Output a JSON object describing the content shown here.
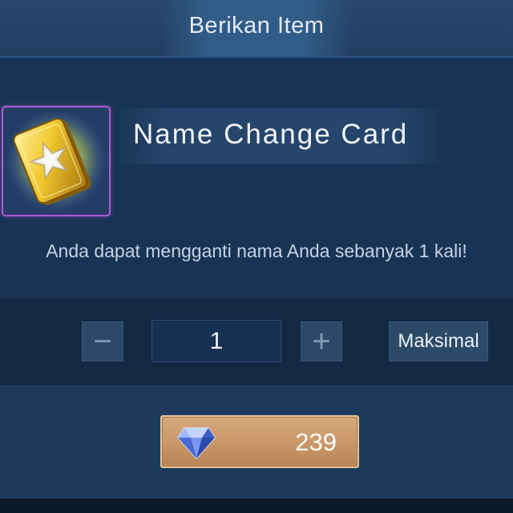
{
  "header": {
    "title": "Berikan Item"
  },
  "item": {
    "name": "Name Change Card",
    "icon": "name-change-card-icon",
    "description": "Anda dapat mengganti nama Anda sebanyak 1 kali!",
    "rarity_border_color": "#b15ad6"
  },
  "quantity": {
    "decrease_symbol": "−",
    "value": "1",
    "increase_symbol": "+",
    "max_label": "Maksimal"
  },
  "purchase": {
    "currency_icon": "diamond-icon",
    "price": "239"
  },
  "colors": {
    "background": "#1d3a5c",
    "buy_button": "#c99667",
    "quantity_bar": "#122843"
  }
}
